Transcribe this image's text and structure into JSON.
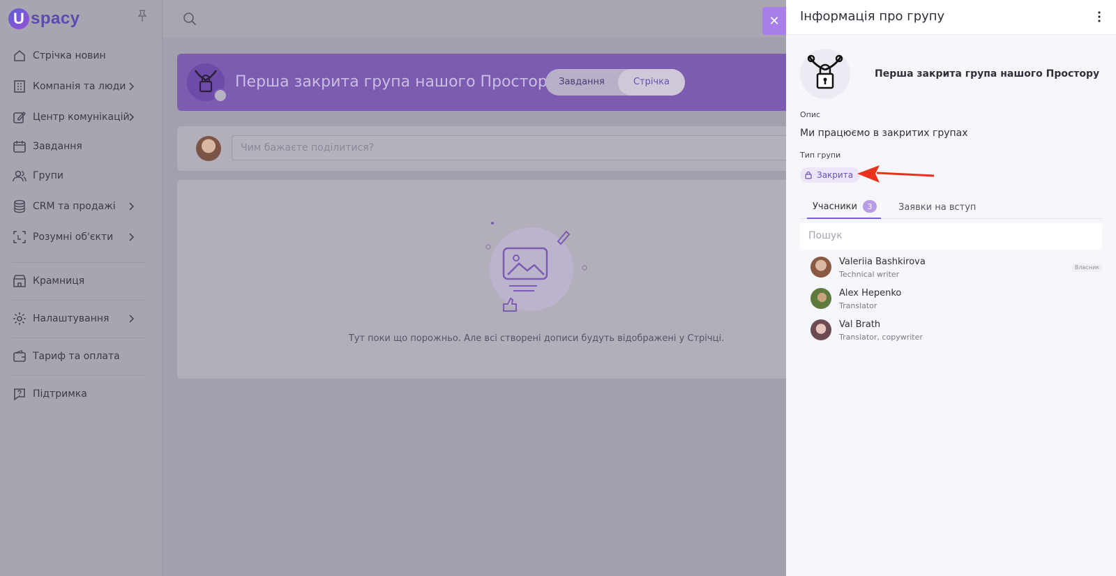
{
  "app": {
    "logo_text": "spacy",
    "logo_letter": "U"
  },
  "sidebar": {
    "items": [
      {
        "label": "Стрічка новин",
        "icon": "home-icon",
        "has_children": false
      },
      {
        "label": "Компанія та люди",
        "icon": "building-icon",
        "has_children": true
      },
      {
        "label": "Центр комунікацій",
        "icon": "edit-icon",
        "has_children": true
      },
      {
        "label": "Завдання",
        "icon": "calendar-icon",
        "has_children": false
      },
      {
        "label": "Групи",
        "icon": "users-icon",
        "has_children": false
      },
      {
        "label": "CRM та продажі",
        "icon": "database-icon",
        "has_children": true
      },
      {
        "label": "Розумні об'єкти",
        "icon": "scan-icon",
        "has_children": true
      },
      {
        "label": "Крамниця",
        "icon": "store-icon",
        "has_children": false
      },
      {
        "label": "Налаштування",
        "icon": "gear-icon",
        "has_children": true
      },
      {
        "label": "Тариф та оплата",
        "icon": "wallet-icon",
        "has_children": false
      },
      {
        "label": "Підтримка",
        "icon": "help-icon",
        "has_children": false
      }
    ]
  },
  "main": {
    "group_banner": {
      "title": "Перша закрита група нашого Простору",
      "tabs": [
        {
          "label": "Завдання"
        },
        {
          "label": "Стрічка",
          "active": true
        }
      ]
    },
    "composer": {
      "placeholder": "Чим бажаєте поділитися?"
    },
    "feed": {
      "empty_text": "Тут поки що порожньо. Але всі створені дописи будуть відображені у Стрічці."
    }
  },
  "panel": {
    "title": "Інформація про групу",
    "group_name": "Перша закрита група нашого Простору",
    "description_label": "Опис",
    "description": "Ми працюємо в закритих групах",
    "type_label": "Тип групи",
    "type_value": "Закрита",
    "tabs": [
      {
        "label": "Учасники",
        "count": "3",
        "active": true
      },
      {
        "label": "Заявки на вступ"
      }
    ],
    "search_placeholder": "Пошук",
    "members": [
      {
        "name": "Valeriia Bashkirova",
        "role": "Technical writer",
        "badge": "Власник"
      },
      {
        "name": "Alex Hepenko",
        "role": "Translator"
      },
      {
        "name": "Val Brath",
        "role": "Translator, copywriter"
      }
    ]
  },
  "colors": {
    "accent": "#7b5cd6",
    "banner": "#7b5cb0",
    "annotation_arrow": "#e8321e"
  }
}
